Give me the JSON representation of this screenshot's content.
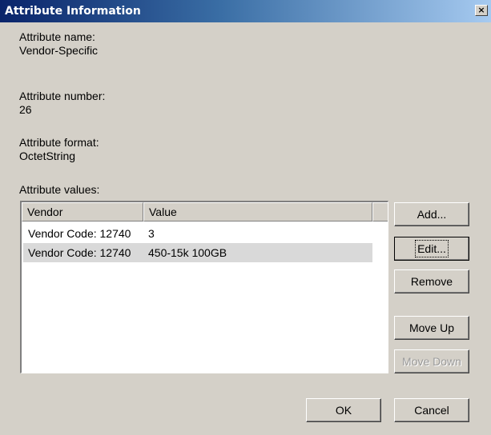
{
  "window": {
    "title": "Attribute Information",
    "close_glyph": "×"
  },
  "attribute": {
    "name_label": "Attribute name:",
    "name_value": "Vendor-Specific",
    "number_label": "Attribute number:",
    "number_value": "26",
    "format_label": "Attribute format:",
    "format_value": "OctetString",
    "values_label": "Attribute values:"
  },
  "table": {
    "columns": [
      "Vendor",
      "Value"
    ],
    "rows": [
      {
        "vendor": "Vendor Code: 12740",
        "value": "3",
        "selected": false
      },
      {
        "vendor": "Vendor Code: 12740",
        "value": "450-15k 100GB",
        "selected": true
      }
    ]
  },
  "buttons": {
    "add": "Add...",
    "edit": "Edit...",
    "remove": "Remove",
    "move_up": "Move Up",
    "move_down": "Move Down",
    "ok": "OK",
    "cancel": "Cancel"
  },
  "colors": {
    "dialog_bg": "#d4d0c8",
    "titlebar_start": "#0a246a",
    "titlebar_end": "#a6caf0",
    "selection_bg": "#d9d9d9"
  }
}
